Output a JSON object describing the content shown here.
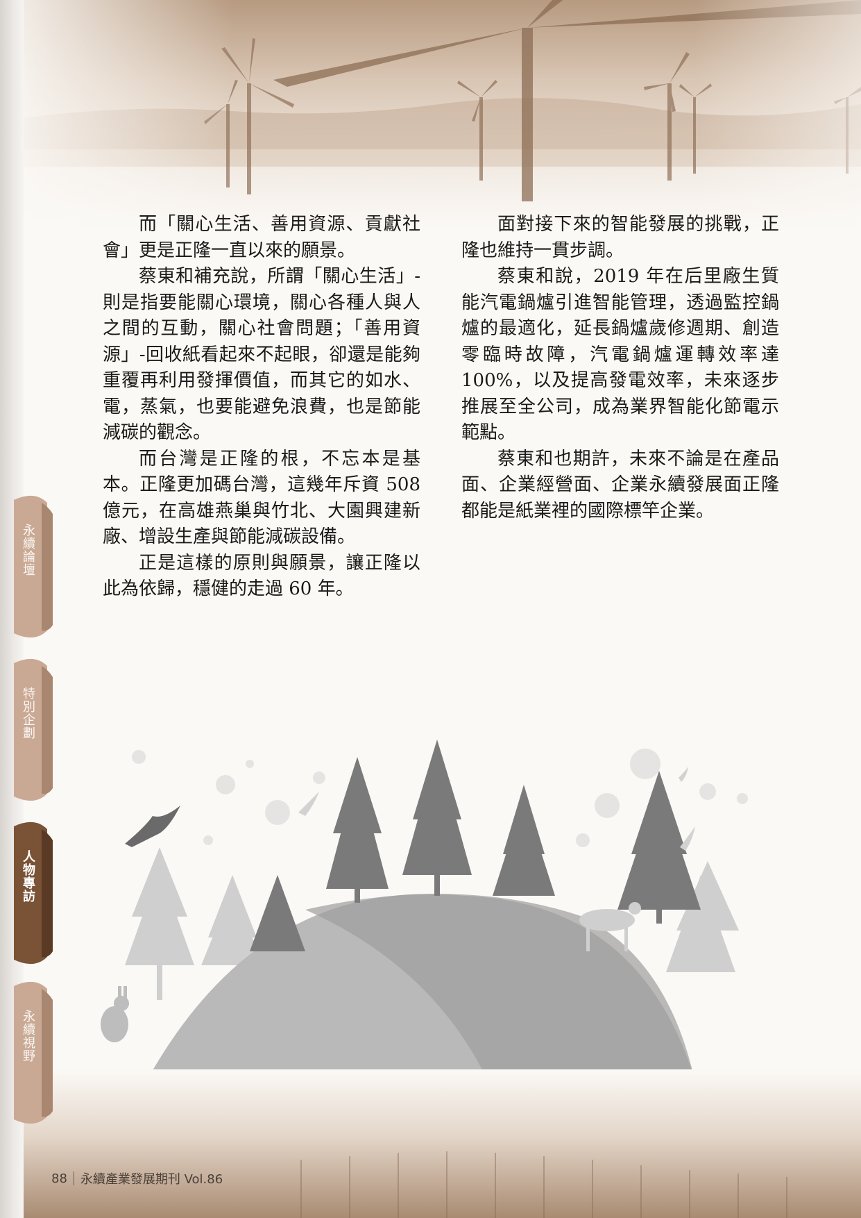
{
  "colors": {
    "accent": "#6b4a30",
    "tab_inactive": "#c9ae97",
    "text": "#1c1a18"
  },
  "left_column": [
    "而「關心生活、善用資源、貢獻社會」更是正隆一直以來的願景。",
    "蔡東和補充說，所謂「關心生活」-則是指要能關心環境，關心各種人與人之間的互動，關心社會問題；「善用資源」-回收紙看起來不起眼，卻還是能夠重覆再利用發揮價值，而其它的如水、電，蒸氣，也要能避免浪費，也是節能減碳的觀念。",
    "而台灣是正隆的根，不忘本是基本。正隆更加碼台灣，這幾年斥資 508 億元，在高雄燕巢與竹北、大園興建新廠、增設生產與節能減碳設備。",
    "正是這樣的原則與願景，讓正隆以此為依歸，穩健的走過 60 年。"
  ],
  "right_column": [
    "面對接下來的智能發展的挑戰，正隆也維持一貫步調。",
    "蔡東和說，2019 年在后里廠生質能汽電鍋爐引進智能管理，透過監控鍋爐的最適化，延長鍋爐歲修週期、創造零臨時故障，汽電鍋爐運轉效率達 100%，以及提高發電效率，未來逐步推展至全公司，成為業界智能化節電示範點。",
    "蔡東和也期許，未來不論是在產品面、企業經營面、企業永續發展面正隆都能是紙業裡的國際標竿企業。"
  ],
  "side_tabs": [
    {
      "label": "永續論壇",
      "active": false
    },
    {
      "label": "特別企劃",
      "active": false
    },
    {
      "label": "人物專訪",
      "active": true
    },
    {
      "label": "永續視野",
      "active": false
    }
  ],
  "footer": {
    "page_number": "88",
    "publication": "永續產業發展期刊 Vol.86"
  },
  "icons": [
    "wind-turbine-icon",
    "tree-icon",
    "bird-icon",
    "rabbit-icon",
    "deer-icon"
  ]
}
